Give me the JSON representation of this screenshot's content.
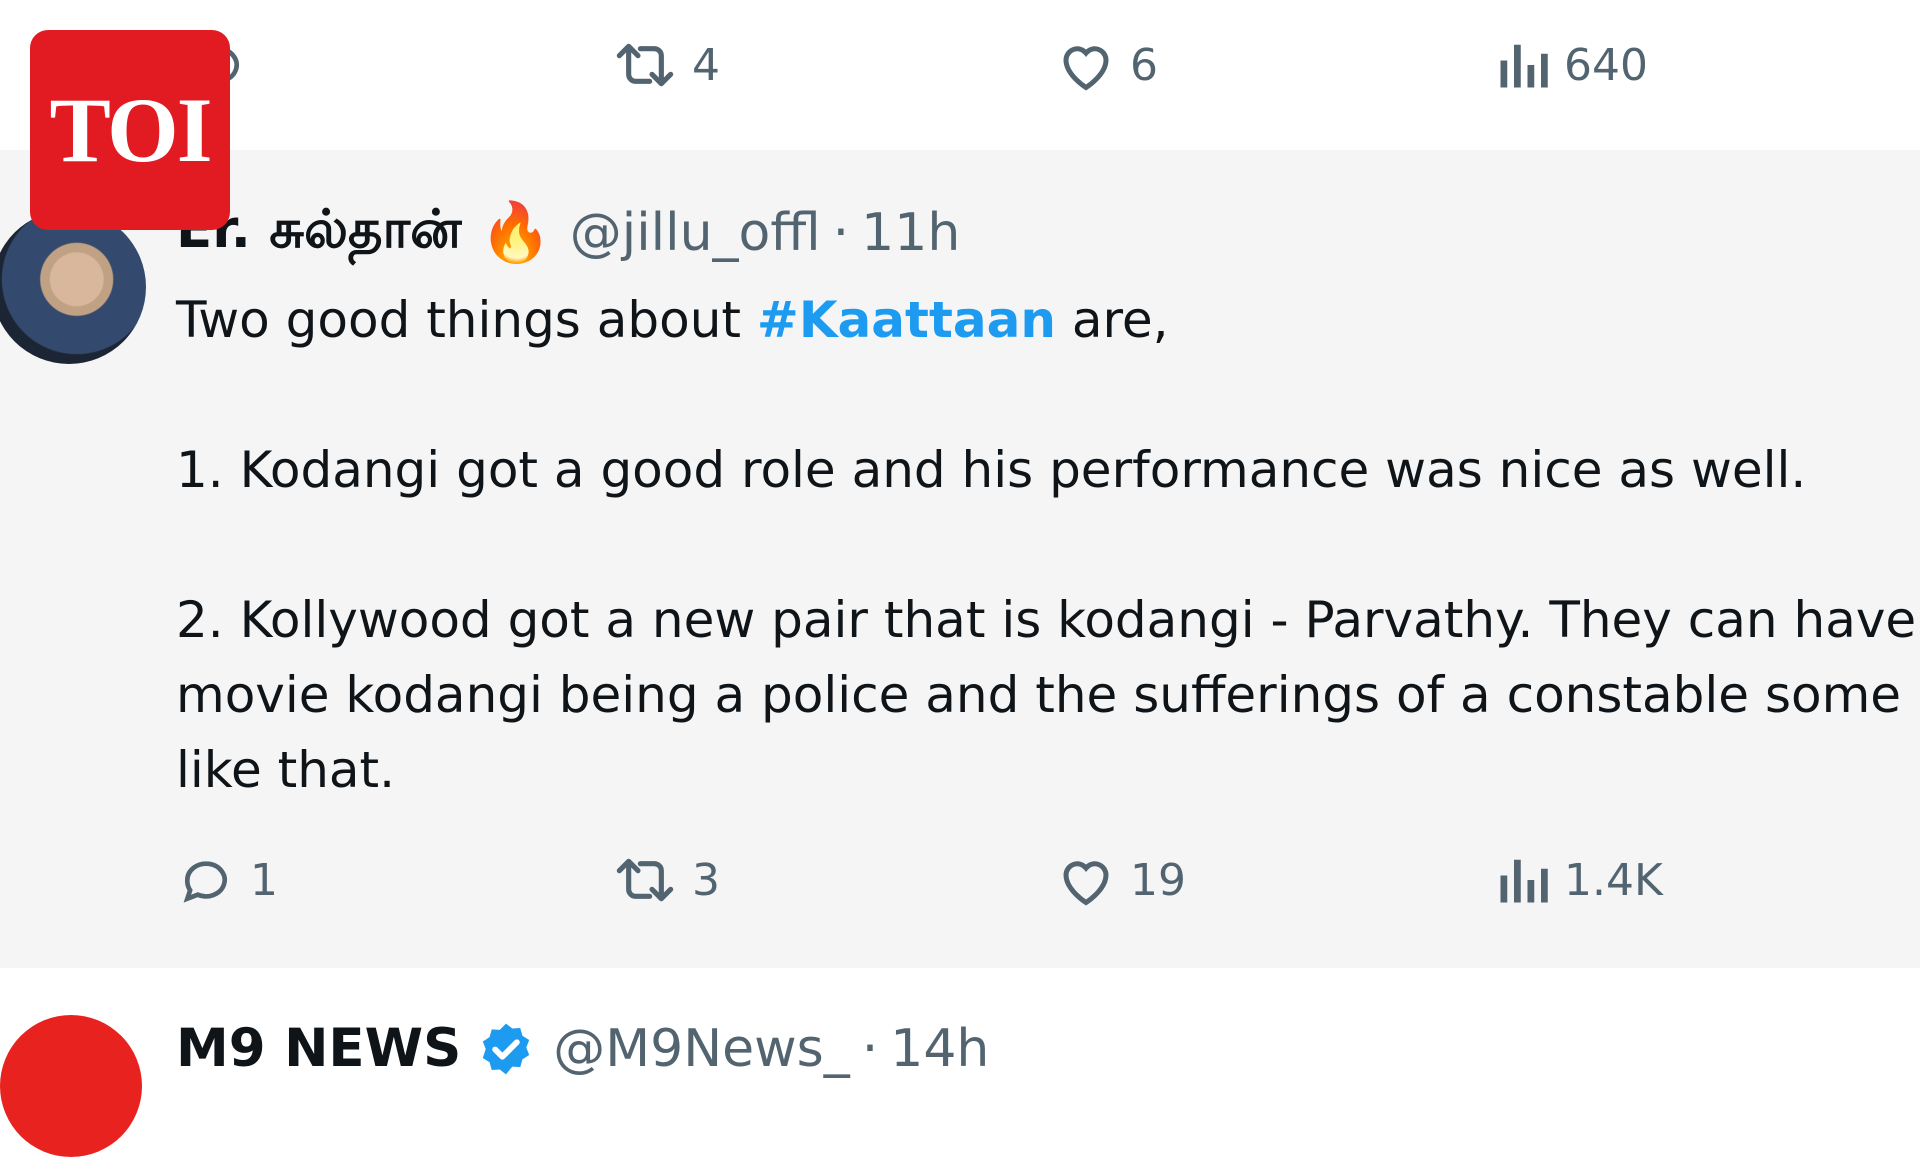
{
  "top_tweet_actions": {
    "retweets": "4",
    "likes": "6",
    "views": "640"
  },
  "tweet": {
    "display_name": "Er. சுல்தான்",
    "emoji": "🔥",
    "handle": "@jillu_offl",
    "separator": "·",
    "time": "11h",
    "lines": [
      {
        "before": "Two good things about ",
        "hashtag": "#Kaattaan",
        "after": " are,"
      },
      {
        "text": "1. Kodangi got a good role and his performance was nice as well."
      },
      {
        "text": "2. Kollywood got a new pair that is kodangi - Parvathy. They can have"
      },
      {
        "text": "movie kodangi being a police and the sufferings of a constable some"
      },
      {
        "text": "like that."
      }
    ],
    "actions": {
      "replies": "1",
      "retweets": "3",
      "likes": "19",
      "views": "1.4K"
    }
  },
  "next_tweet": {
    "display_name": "M9 NEWS",
    "handle": "@M9News_",
    "separator": "·",
    "time": "14h"
  },
  "watermark": {
    "text": "TOI",
    "color": "#e21b22"
  },
  "colors": {
    "hashtag": "#1d9bf0",
    "muted": "#536471",
    "verified": "#1d9bf0",
    "focus_background": "#f5f5f5"
  }
}
